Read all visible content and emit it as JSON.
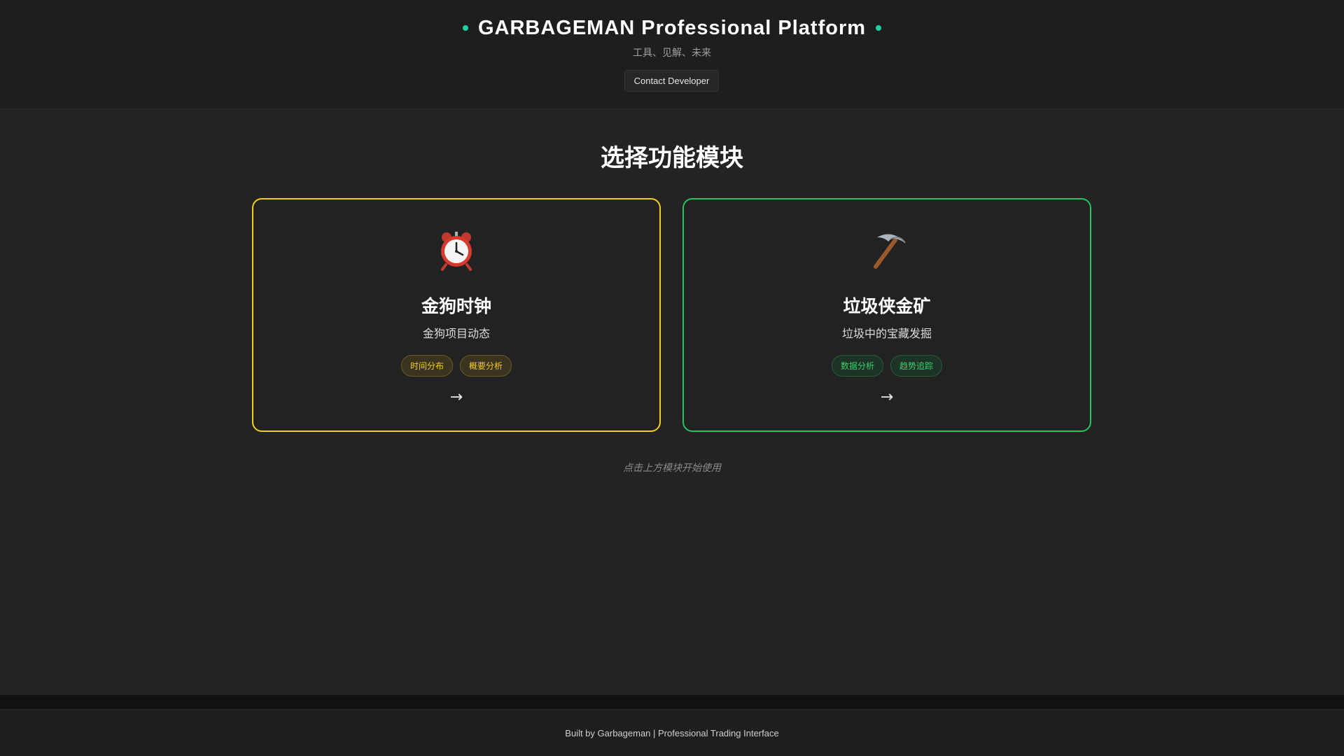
{
  "header": {
    "title": "GARBAGEMAN Professional Platform",
    "tagline": "工具、见解、未来",
    "contact_label": "Contact Developer",
    "accent_color": "#1fd1a0"
  },
  "main": {
    "section_title": "选择功能模块",
    "cards": [
      {
        "icon": "alarm-clock-icon",
        "title": "金狗时钟",
        "description": "金狗项目动态",
        "tags": [
          "时间分布",
          "概要分析"
        ],
        "arrow": "→",
        "accent_color": "#f4ce1c"
      },
      {
        "icon": "pickaxe-icon",
        "title": "垃圾侠金矿",
        "description": "垃圾中的宝藏发掘",
        "tags": [
          "数据分析",
          "趋势追踪"
        ],
        "arrow": "→",
        "accent_color": "#22c55e"
      }
    ],
    "hint": "点击上方模块开始使用"
  },
  "footer": {
    "text": "Built by Garbageman | Professional Trading Interface"
  }
}
